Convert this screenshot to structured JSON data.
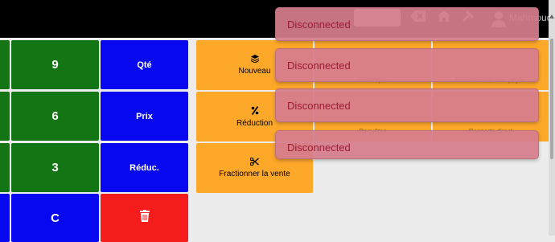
{
  "topbar": {
    "user_name": "Mahmoud",
    "icons": [
      "backspace-icon",
      "home-icon",
      "tools-icon",
      "user-icon"
    ]
  },
  "keypad": {
    "keys": [
      "9",
      "Qté",
      "6",
      "Prix",
      "3",
      "Réduc.",
      "C"
    ],
    "delete_icon": "trash-icon"
  },
  "actions": [
    {
      "label": "Nouveau",
      "icon": "layers-icon"
    },
    {
      "label": "Réduction",
      "icon": "percent-icon"
    },
    {
      "label": "Fractionner la vente",
      "icon": "scissors-icon"
    }
  ],
  "background_items": [
    "Historique",
    "Produit/Vente non payée",
    "Requêtes",
    "Rapports direct"
  ],
  "notifications": [
    "Disconnected",
    "Disconnected",
    "Disconnected",
    "Disconnected"
  ],
  "colors": {
    "green": "#137513",
    "blue": "#0707f0",
    "red": "#f51c1c",
    "orange": "#fea82a",
    "toast_bg": "#d57d8c",
    "toast_text": "#9b1b36"
  }
}
